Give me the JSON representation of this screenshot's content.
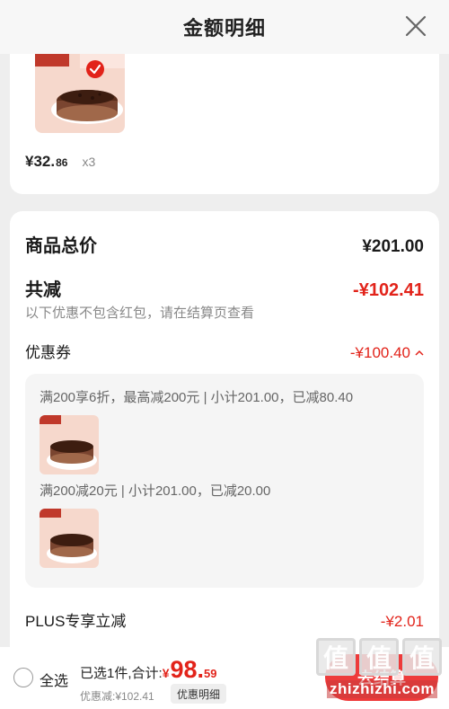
{
  "header": {
    "title": "金额明细"
  },
  "product": {
    "price_main": "¥32.",
    "price_decimal": "86",
    "quantity": "x3"
  },
  "summary": {
    "total_label": "商品总价",
    "total_value": "¥201.00",
    "reduce_label": "共减",
    "reduce_value": "-¥102.41",
    "note": "以下优惠不包含红包，请在结算页查看",
    "coupon_label": "优惠券",
    "coupon_value": "-¥100.40",
    "coupons": [
      {
        "text": "满200享6折，最高减200元 | 小计201.00，已减80.40"
      },
      {
        "text": "满200减20元 | 小计201.00，已减20.00"
      }
    ],
    "plus_label": "PLUS专享立减",
    "plus_value": "-¥2.01"
  },
  "footer": {
    "select_all": "全选",
    "selected_text": "已选1件,合计:",
    "total_symbol": "¥",
    "total_int": "98.",
    "total_dec": "59",
    "discount_text": "优惠减:¥102.41",
    "detail_button": "优惠明细",
    "checkout_button": "去结算"
  },
  "watermark": {
    "chars": [
      "值",
      "值",
      "值"
    ],
    "domain": "zhizhizhi.com"
  },
  "colors": {
    "accent_red": "#e2231a",
    "checkout_red": "#ee3a3a"
  }
}
